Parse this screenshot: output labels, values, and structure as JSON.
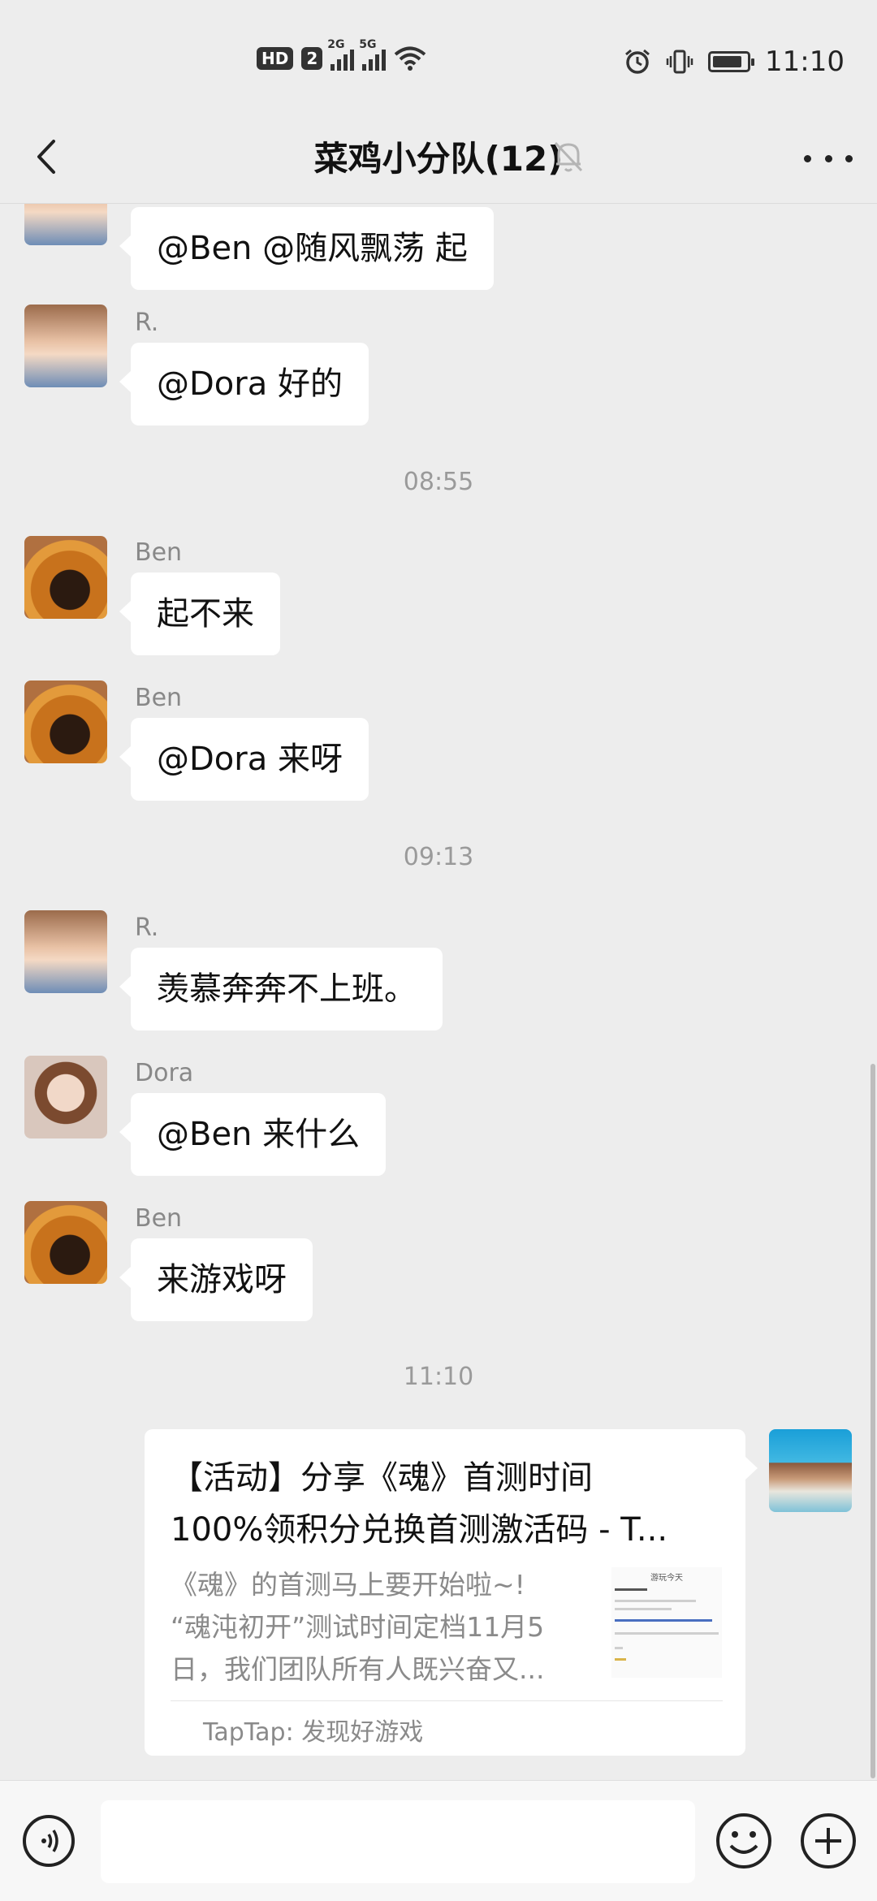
{
  "status_bar": {
    "network_badge": "HD",
    "sim_label": "2",
    "signal_1_label": "2G",
    "signal_2_label": "5G",
    "time": "11:10",
    "battery_level": 0.88
  },
  "header": {
    "title": "菜鸡小分队(12)",
    "back_icon": "chevron-left-icon",
    "mute_icon": "bell-off-icon",
    "more_icon": "ellipsis-icon"
  },
  "messages": [
    {
      "sender": "",
      "text": "@Ben @随风飘荡  起"
    },
    {
      "sender": "R.",
      "text": "@Dora  好的"
    },
    {
      "timestamp": "08:55"
    },
    {
      "sender": "Ben",
      "text": "起不来"
    },
    {
      "sender": "Ben",
      "text": "@Dora  来呀"
    },
    {
      "timestamp": "09:13"
    },
    {
      "sender": "R.",
      "text": "羡慕奔奔不上班。"
    },
    {
      "sender": "Dora",
      "text": "@Ben  来什么"
    },
    {
      "sender": "Ben",
      "text": "来游戏呀"
    },
    {
      "timestamp": "11:10"
    }
  ],
  "shared_card": {
    "title_line1": "【活动】分享《魂》首测时间",
    "title_line2": "100%领积分兑换首测激活码 - T...",
    "desc_line1": "《魂》的首测马上要开始啦~!",
    "desc_line2": "“魂沌初开”测试时间定档11月5",
    "desc_line3": "日，我们团队所有人既兴奋又...",
    "source": "TapTap: 发现好游戏",
    "thumb_title": "游玩今天"
  },
  "input_bar": {
    "voice_icon": "voice-icon",
    "emoji_icon": "emoji-icon",
    "plus_icon": "plus-circle-icon",
    "placeholder": ""
  },
  "colors": {
    "background": "#ededed",
    "bubble": "#ffffff",
    "sender": "#888888",
    "timestamp": "#9a9a9a"
  }
}
